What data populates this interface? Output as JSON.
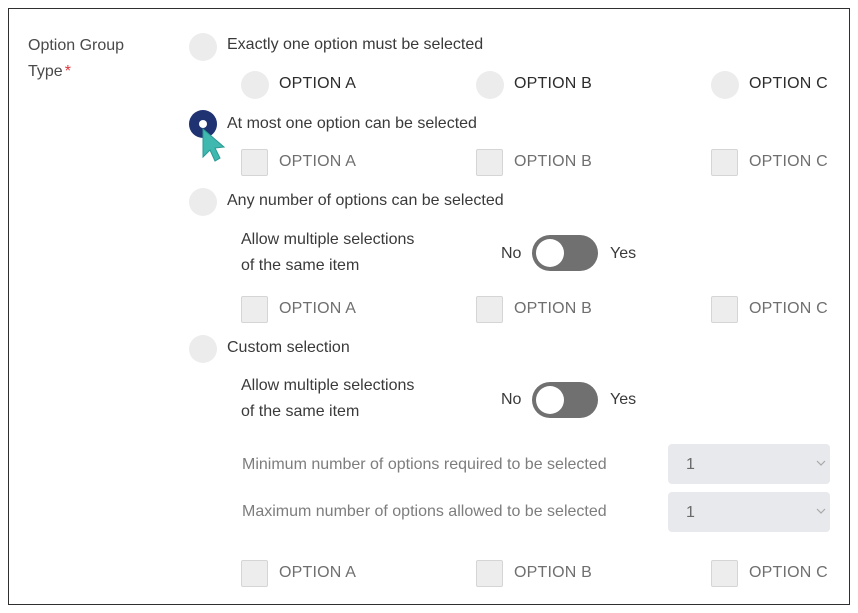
{
  "group": {
    "label_line1": "Option Group",
    "label_line2": "Type",
    "required_mark": "*"
  },
  "types": [
    {
      "label": "Exactly one option must be selected",
      "selected": false,
      "options": [
        "OPTION A",
        "OPTION B",
        "OPTION C"
      ]
    },
    {
      "label": "At most one option can be selected",
      "selected": true,
      "options": [
        "OPTION A",
        "OPTION B",
        "OPTION C"
      ]
    },
    {
      "label": "Any number of options can be selected",
      "selected": false,
      "allow_multiple_line1": "Allow multiple selections",
      "allow_multiple_line2": "of the same item",
      "toggle_no": "No",
      "toggle_yes": "Yes",
      "toggle_on": false,
      "options": [
        "OPTION A",
        "OPTION B",
        "OPTION C"
      ]
    },
    {
      "label": "Custom selection",
      "selected": false,
      "allow_multiple_line1": "Allow multiple selections",
      "allow_multiple_line2": "of the same item",
      "toggle_no": "No",
      "toggle_yes": "Yes",
      "toggle_on": false,
      "min_label": "Minimum number of options required to be selected",
      "min_value": "1",
      "max_label": "Maximum number of options allowed to be selected",
      "max_value": "1",
      "options": [
        "OPTION A",
        "OPTION B",
        "OPTION C"
      ]
    }
  ],
  "colors": {
    "selected_radio": "#1f3272",
    "required": "#e0353b",
    "cursor": "#3fb8b0",
    "toggle_track": "#707070"
  },
  "icons": {
    "cursor": "pointer-cursor-icon",
    "chevron": "chevron-down-icon"
  }
}
